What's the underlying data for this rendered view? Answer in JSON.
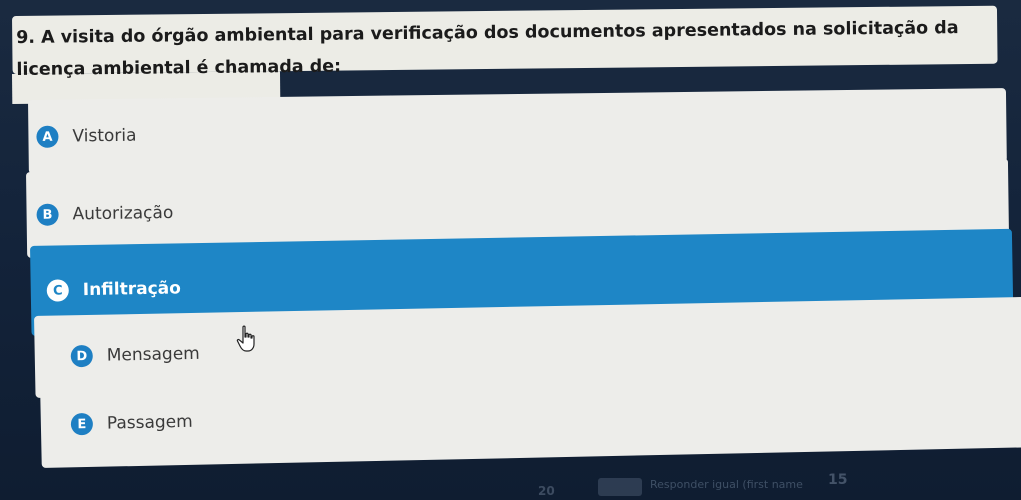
{
  "question": {
    "text": "9. A visita do órgão ambiental para verificação dos documentos apresentados na solicitação da licença ambiental é chamada de:"
  },
  "options": [
    {
      "letter": "A",
      "label": "Vistoria",
      "selected": false
    },
    {
      "letter": "B",
      "label": "Autorização",
      "selected": false
    },
    {
      "letter": "C",
      "label": "Infiltração",
      "selected": true
    },
    {
      "letter": "D",
      "label": "Mensagem",
      "selected": false
    },
    {
      "letter": "E",
      "label": "Passagem",
      "selected": false
    }
  ],
  "footer": {
    "hint": "Responder igual (first name",
    "number": "15",
    "number_left": "20"
  },
  "colors": {
    "accent": "#1e86c6",
    "option_bg": "#ededea",
    "background": "#142236"
  },
  "icons": {
    "cursor": "hand-pointer-icon"
  }
}
